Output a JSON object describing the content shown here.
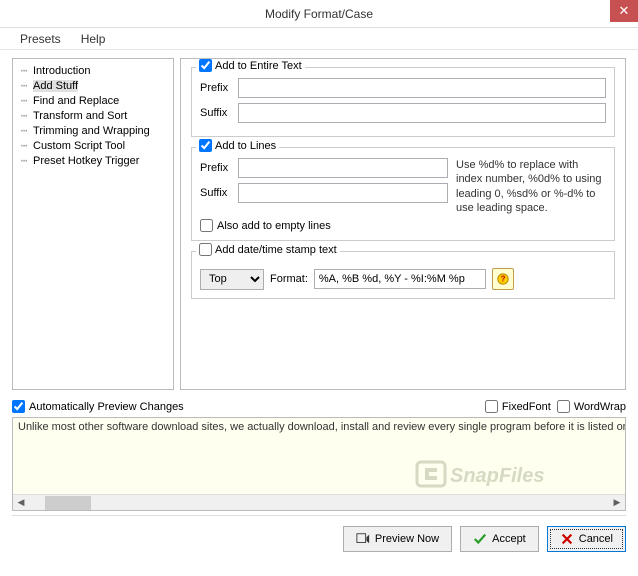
{
  "title": "Modify Format/Case",
  "menu": {
    "presets": "Presets",
    "help": "Help"
  },
  "tree": {
    "items": [
      {
        "label": "Introduction",
        "selected": false
      },
      {
        "label": "Add Stuff",
        "selected": true
      },
      {
        "label": "Find and Replace",
        "selected": false
      },
      {
        "label": "Transform and Sort",
        "selected": false
      },
      {
        "label": "Trimming and Wrapping",
        "selected": false
      },
      {
        "label": "Custom Script Tool",
        "selected": false
      },
      {
        "label": "Preset Hotkey Trigger",
        "selected": false
      }
    ]
  },
  "entireText": {
    "legend": "Add to Entire Text",
    "checked": true,
    "prefixLabel": "Prefix",
    "prefixValue": "",
    "suffixLabel": "Suffix",
    "suffixValue": ""
  },
  "lines": {
    "legend": "Add to Lines",
    "checked": true,
    "prefixLabel": "Prefix",
    "prefixValue": "",
    "suffixLabel": "Suffix",
    "suffixValue": "",
    "hint": "Use %d% to replace with index number, %0d% to using leading 0, %sd% or %-d% to use leading space.",
    "emptyLabel": "Also add to empty lines",
    "emptyChecked": false
  },
  "datetime": {
    "legend": "Add date/time stamp text",
    "checked": false,
    "position": "Top",
    "formatLabel": "Format:",
    "formatValue": "%A, %B %d, %Y - %I:%M %p"
  },
  "options": {
    "autoPreview": "Automatically Preview Changes",
    "autoPreviewChecked": true,
    "fixedFont": "FixedFont",
    "fixedFontChecked": false,
    "wordWrap": "WordWrap",
    "wordWrapChecked": false
  },
  "preview": {
    "text": "Unlike most other software download sites, we actually download, install and review every single program before it is listed on the sit"
  },
  "buttons": {
    "previewNow": "Preview Now",
    "accept": "Accept",
    "cancel": "Cancel"
  }
}
